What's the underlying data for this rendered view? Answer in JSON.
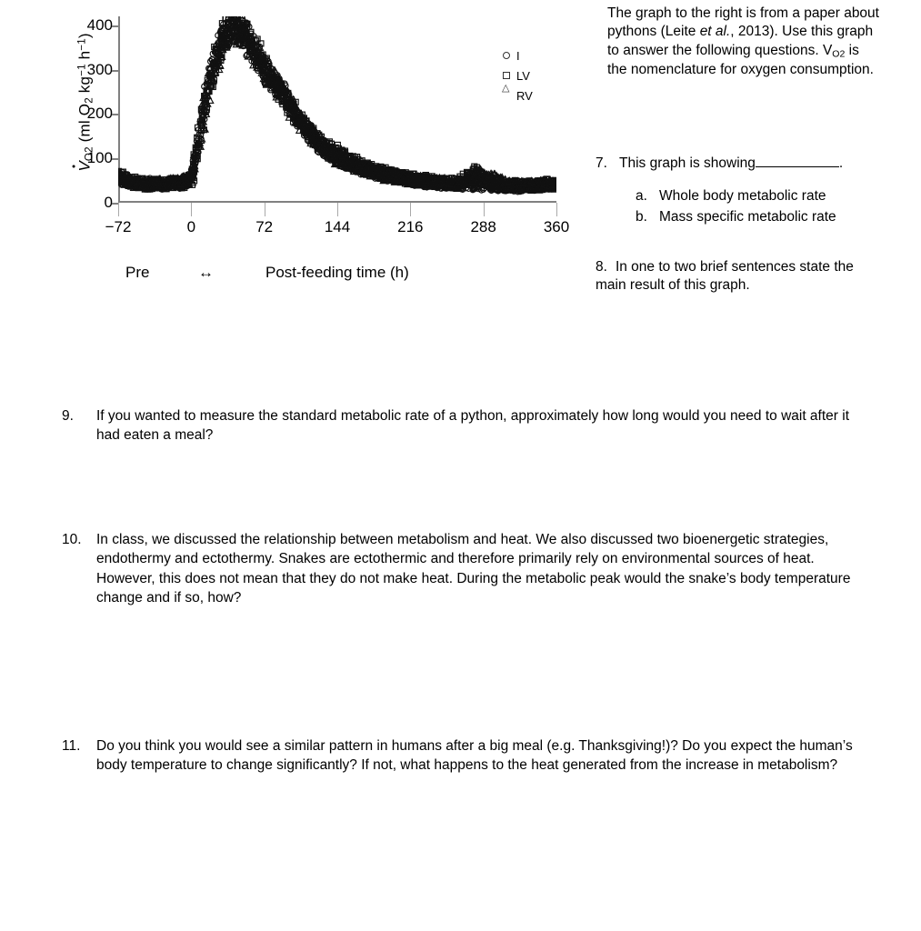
{
  "intro": {
    "text_before_ital": "The graph to the right is from a paper about pythons (Leite ",
    "italic": "et al.",
    "text_after_ital": ", 2013). Use this graph to answer the following questions. V",
    "subscript": "O2",
    "text_tail": " is the nomenclature for oxygen consumption."
  },
  "figure": {
    "ylabel_prefix": "V",
    "ylabel_sub": "O",
    "ylabel_sub2": "2",
    "ylabel_unit_open": " (ml O",
    "ylabel_unit_sub": "2",
    "ylabel_kg": " kg",
    "ylabel_kg_sup": "−1",
    "ylabel_h": " h",
    "ylabel_h_sup": "−1",
    "ylabel_close": ")",
    "xlabel_pre": "Pre",
    "xlabel_arrow": "↔",
    "xlabel_post": "Post-feeding time (h)",
    "legend": [
      {
        "marker": "circle-marker-icon",
        "label": "I"
      },
      {
        "marker": "square-marker-icon",
        "label": "LV"
      },
      {
        "marker": "triangle-marker-icon",
        "label": "RV"
      }
    ]
  },
  "chart_data": {
    "type": "scatter",
    "title": "",
    "xlabel": "Post-feeding time (h)",
    "ylabel": "VO2 (ml O2 kg-1 h-1)",
    "xlim": [
      -72,
      360
    ],
    "ylim": [
      0,
      420
    ],
    "xticks": [
      -72,
      0,
      72,
      144,
      216,
      288,
      360
    ],
    "yticks": [
      0,
      100,
      200,
      300,
      400
    ],
    "grid": false,
    "legend_position": "right-outside",
    "annotations": [
      "Pre",
      "↔",
      "Post-feeding time (h)"
    ],
    "series": [
      {
        "name": "I",
        "marker": "circle",
        "x": [
          -72,
          -66,
          -60,
          -54,
          -48,
          -42,
          -36,
          -30,
          -24,
          -18,
          -12,
          -6,
          0,
          4,
          8,
          12,
          16,
          20,
          24,
          28,
          32,
          36,
          40,
          44,
          48,
          54,
          60,
          66,
          72,
          80,
          88,
          96,
          104,
          112,
          120,
          132,
          144,
          156,
          168,
          180,
          192,
          204,
          216,
          228,
          240,
          252,
          264,
          276,
          288,
          300,
          312,
          324,
          336,
          348,
          360
        ],
        "y": [
          58,
          52,
          48,
          45,
          42,
          44,
          40,
          43,
          41,
          45,
          42,
          48,
          55,
          95,
          150,
          215,
          255,
          300,
          330,
          355,
          372,
          385,
          395,
          400,
          390,
          370,
          345,
          320,
          300,
          280,
          255,
          225,
          195,
          170,
          150,
          120,
          100,
          88,
          78,
          70,
          62,
          58,
          52,
          48,
          45,
          43,
          42,
          40,
          40,
          38,
          37,
          36,
          38,
          40,
          42
        ]
      },
      {
        "name": "LV",
        "marker": "square",
        "x": [
          -72,
          -64,
          -56,
          -48,
          -40,
          -32,
          -24,
          -16,
          -8,
          0,
          6,
          12,
          18,
          24,
          30,
          36,
          42,
          48,
          56,
          64,
          72,
          84,
          96,
          108,
          120,
          136,
          152,
          168,
          184,
          200,
          216,
          232,
          248,
          264,
          280,
          296,
          312,
          328,
          344,
          360
        ],
        "y": [
          60,
          50,
          46,
          43,
          41,
          44,
          42,
          46,
          44,
          52,
          120,
          205,
          270,
          325,
          365,
          390,
          405,
          398,
          375,
          340,
          305,
          265,
          225,
          180,
          150,
          122,
          100,
          82,
          70,
          60,
          54,
          50,
          46,
          44,
          70,
          42,
          40,
          38,
          40,
          44
        ]
      },
      {
        "name": "RV",
        "marker": "triangle",
        "x": [
          -72,
          -60,
          -48,
          -36,
          -24,
          -12,
          0,
          10,
          20,
          30,
          40,
          50,
          60,
          72,
          88,
          104,
          120,
          144,
          168,
          192,
          216,
          240,
          264,
          288,
          312,
          336,
          360
        ],
        "y": [
          55,
          47,
          42,
          44,
          43,
          46,
          54,
          170,
          290,
          355,
          392,
          385,
          345,
          300,
          250,
          195,
          148,
          100,
          78,
          62,
          52,
          46,
          43,
          65,
          40,
          38,
          42
        ]
      }
    ],
    "description": "Oxygen consumption of pythons before and after feeding; baseline near 40-60 ml O2 kg-1 h-1 rises to a peak near 400 around 24-48 h post-feeding, then declines back to baseline by about 216-288 h."
  },
  "q7": {
    "number": "7.",
    "stem": "This graph is showing",
    "period": ".",
    "choices": [
      {
        "letter": "a.",
        "text": "Whole body metabolic rate"
      },
      {
        "letter": "b.",
        "text": "Mass specific metabolic rate"
      }
    ]
  },
  "q8": {
    "number": "8.",
    "text": "In one to two brief sentences state the main result of this graph."
  },
  "q9": {
    "number": "9.",
    "text": "If you wanted to measure the standard metabolic rate of a python, approximately how long would you need to wait after it had eaten a meal?"
  },
  "q10": {
    "number": "10.",
    "text": "In class, we discussed the relationship between metabolism and heat.  We also discussed two bioenergetic strategies, endothermy and ectothermy.  Snakes are ectothermic and therefore primarily rely on environmental sources of heat.  However, this does not mean that they do not make heat.  During the metabolic peak would the snake’s body temperature change and if so, how?"
  },
  "q11": {
    "number": "11.",
    "text": "Do you think you would see a similar pattern in humans after a big meal (e.g. Thanksgiving!)?  Do you expect the human’s body temperature to change significantly?  If not, what happens to the heat generated from the increase in metabolism?"
  }
}
